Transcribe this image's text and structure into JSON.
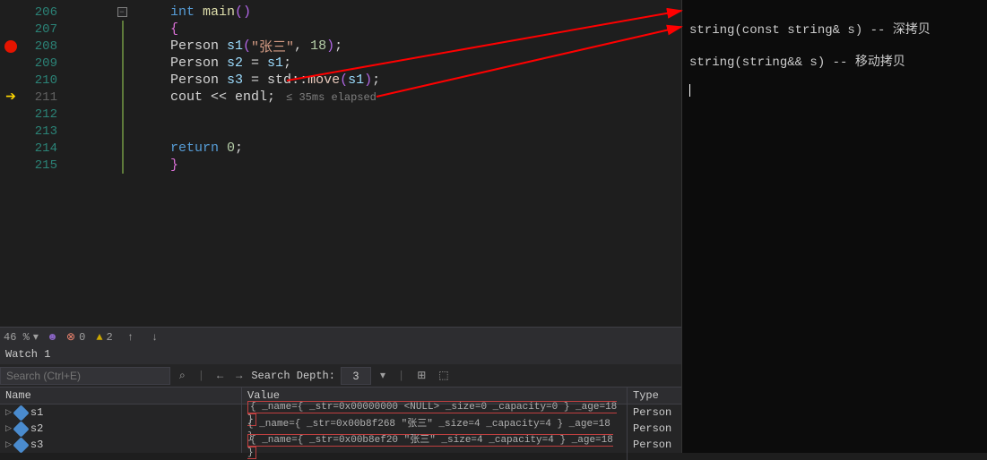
{
  "editor": {
    "lines": [
      {
        "num": "206",
        "bp": false,
        "arrow": false,
        "fold": "box"
      },
      {
        "num": "207",
        "bp": false,
        "arrow": false
      },
      {
        "num": "208",
        "bp": true,
        "arrow": false
      },
      {
        "num": "209",
        "bp": false,
        "arrow": false
      },
      {
        "num": "210",
        "bp": false,
        "arrow": false
      },
      {
        "num": "211",
        "bp": false,
        "arrow": true,
        "current": true
      },
      {
        "num": "212",
        "bp": false,
        "arrow": false
      },
      {
        "num": "213",
        "bp": false,
        "arrow": false
      },
      {
        "num": "214",
        "bp": false,
        "arrow": false
      },
      {
        "num": "215",
        "bp": false,
        "arrow": false
      }
    ],
    "code": {
      "l206": {
        "kw1": "int",
        "fn": " main",
        "p1": "(",
        "p2": ")"
      },
      "l207": {
        "brace": "{"
      },
      "l208": {
        "type": "Person ",
        "var": "s1",
        "p1": "(",
        "str": "\"张三\"",
        "c": ", ",
        "num": "18",
        "p2": ")",
        "semi": ";"
      },
      "l209": {
        "type": "Person ",
        "var": "s2",
        "eq": " = ",
        "rhs": "s1",
        "semi": ";"
      },
      "l210": {
        "type": "Person ",
        "var": "s3",
        "eq": " = ",
        "ns": "std",
        "cc": "::",
        "mv": "move",
        "p1": "(",
        "arg": "s1",
        "p2": ")",
        "semi": ";"
      },
      "l211": {
        "cout": "cout",
        "op": " << ",
        "endl": "endl",
        "semi": ";",
        "hint": "≤ 35ms elapsed"
      },
      "l214": {
        "kw": "return ",
        "num": "0",
        "semi": ";"
      },
      "l215": {
        "brace": "}"
      }
    }
  },
  "status": {
    "zoom": "46 %",
    "errors": "0",
    "warnings": "2"
  },
  "watch": {
    "title": "Watch 1",
    "search_placeholder": "Search (Ctrl+E)",
    "depth_label": "Search Depth:",
    "depth_value": "3",
    "columns": {
      "name": "Name",
      "value": "Value",
      "type": "Type"
    },
    "rows": [
      {
        "name": "s1",
        "value": "{ _name={ _str=0x00000000 <NULL> _size=0 _capacity=0 } _age=18 }",
        "type": "Person",
        "box": true
      },
      {
        "name": "s2",
        "value": "{ _name={ _str=0x00b8f268 \"张三\" _size=4 _capacity=4 } _age=18 }",
        "type": "Person",
        "box": false
      },
      {
        "name": "s3",
        "value": "{ _name={ _str=0x00b8ef20 \"张三\" _size=4 _capacity=4 } _age=18 }",
        "type": "Person",
        "box": true
      }
    ]
  },
  "console": {
    "line1": "string(const string& s) -- 深拷贝",
    "line2": "string(string&& s) -- 移动拷贝"
  },
  "icons": {
    "search": "⌕",
    "arrow_left": "←",
    "arrow_right": "→",
    "up": "↑",
    "down": "↓",
    "stepper": "▾"
  }
}
